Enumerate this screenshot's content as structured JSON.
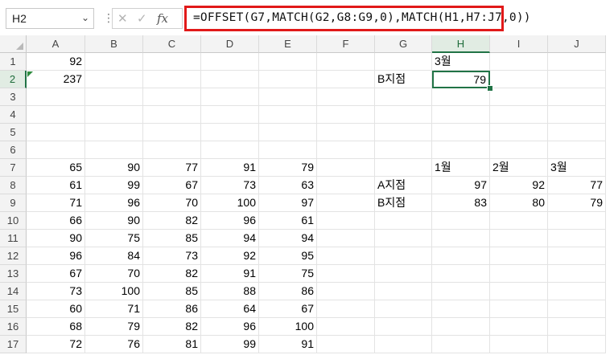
{
  "formula_bar": {
    "name_box": "H2",
    "name_box_dropdown_icon": "chevron-down-icon",
    "separator": "⋮",
    "cancel_icon": "✕",
    "enter_icon": "✓",
    "function_label": "fx",
    "formula": "=OFFSET(G7,MATCH(G2,G8:G9,0),MATCH(H1,H7:J7,0))",
    "highlight_color": "#e11919"
  },
  "sheet": {
    "columns": [
      "A",
      "B",
      "C",
      "D",
      "E",
      "F",
      "G",
      "H",
      "I",
      "J"
    ],
    "rows": [
      "1",
      "2",
      "3",
      "4",
      "5",
      "6",
      "7",
      "8",
      "9",
      "10",
      "11",
      "12",
      "13",
      "14",
      "15",
      "16",
      "17"
    ],
    "selected_column": "H",
    "selected_row": "2",
    "accent_color": "#217346",
    "cells": {
      "A1": "92",
      "A2": "237",
      "H1": "3월",
      "G2": "B지점",
      "H2": "79",
      "H7": "1월",
      "I7": "2월",
      "J7": "3월",
      "G8": "A지점",
      "H8": "97",
      "I8": "92",
      "J8": "77",
      "G9": "B지점",
      "H9": "83",
      "I9": "80",
      "J9": "79",
      "A7": "65",
      "B7": "90",
      "C7": "77",
      "D7": "91",
      "E7": "79",
      "A8": "61",
      "B8": "99",
      "C8": "67",
      "D8": "73",
      "E8": "63",
      "A9": "71",
      "B9": "96",
      "C9": "70",
      "D9": "100",
      "E9": "97",
      "A10": "66",
      "B10": "90",
      "C10": "82",
      "D10": "96",
      "E10": "61",
      "A11": "90",
      "B11": "75",
      "C11": "85",
      "D11": "94",
      "E11": "94",
      "A12": "96",
      "B12": "84",
      "C12": "73",
      "D12": "92",
      "E12": "95",
      "A13": "67",
      "B13": "70",
      "C13": "82",
      "D13": "91",
      "E13": "75",
      "A14": "73",
      "B14": "100",
      "C14": "85",
      "D14": "88",
      "E14": "86",
      "A15": "60",
      "B15": "71",
      "C15": "86",
      "D15": "64",
      "E15": "67",
      "A16": "68",
      "B16": "79",
      "C16": "82",
      "D16": "96",
      "E16": "100",
      "A17": "72",
      "B17": "76",
      "C17": "81",
      "D17": "99",
      "E17": "91"
    }
  }
}
